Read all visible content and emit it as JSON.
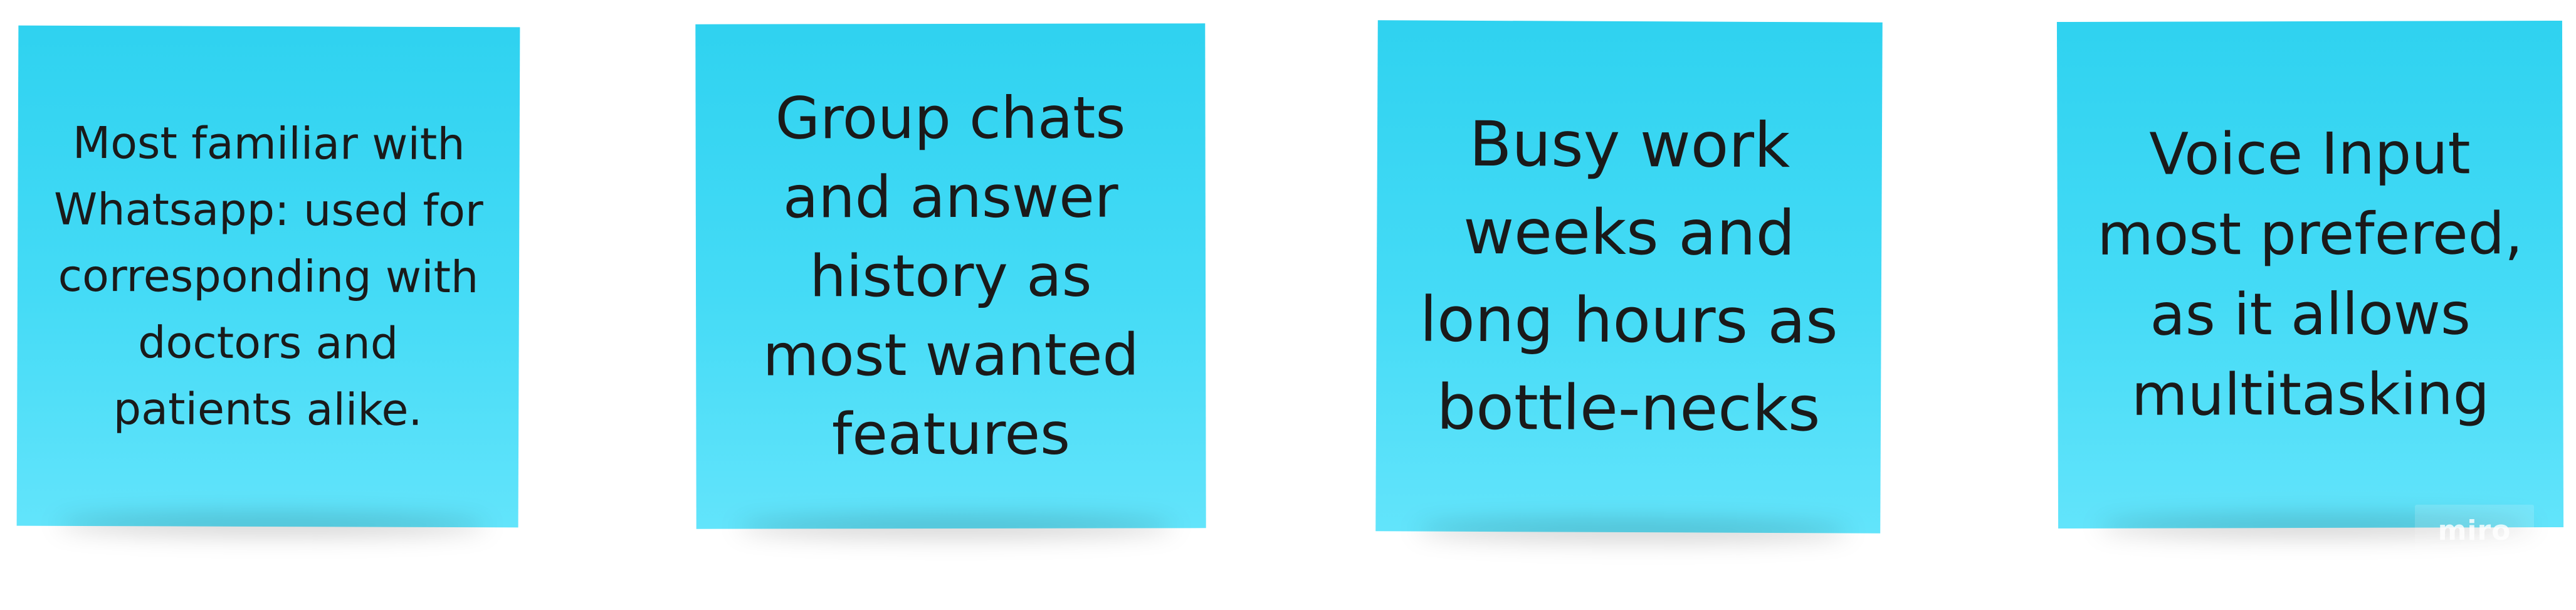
{
  "board": {
    "notes": [
      {
        "text": "Most familiar with Whatsapp: used for corresponding with doctors and patients alike."
      },
      {
        "text": "Group chats and answer history as most wanted features"
      },
      {
        "text": "Busy work weeks and long hours as bottle-necks"
      },
      {
        "text": "Voice Input most prefered, as it allows multitasking"
      }
    ],
    "watermark": "miro",
    "colors": {
      "note": "#45dbf6",
      "text": "#1a1a1a",
      "background": "#ffffff"
    }
  }
}
